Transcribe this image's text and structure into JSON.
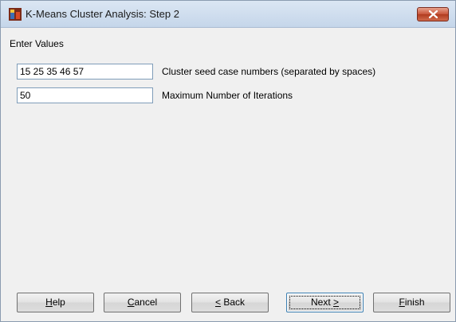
{
  "window": {
    "title": "K-Means Cluster Analysis: Step 2",
    "close_label": "close"
  },
  "main": {
    "heading": "Enter Values",
    "fields": [
      {
        "value": "15 25 35 46 57",
        "label": "Cluster seed case numbers (separated by spaces)"
      },
      {
        "value": "50",
        "label": "Maximum Number of Iterations"
      }
    ]
  },
  "buttons": {
    "help": {
      "prefix": "",
      "mnemonic": "H",
      "suffix": "elp"
    },
    "cancel": {
      "prefix": "",
      "mnemonic": "C",
      "suffix": "ancel"
    },
    "back": {
      "prefix": "",
      "mnemonic": "<",
      "suffix": " Back"
    },
    "next": {
      "prefix": "Next ",
      "mnemonic": ">",
      "suffix": ""
    },
    "finish": {
      "prefix": "",
      "mnemonic": "F",
      "suffix": "inish"
    }
  },
  "colors": {
    "titlebar": "#c5d6ea",
    "close_button": "#c75338",
    "default_button_border": "#3c7fb1"
  }
}
